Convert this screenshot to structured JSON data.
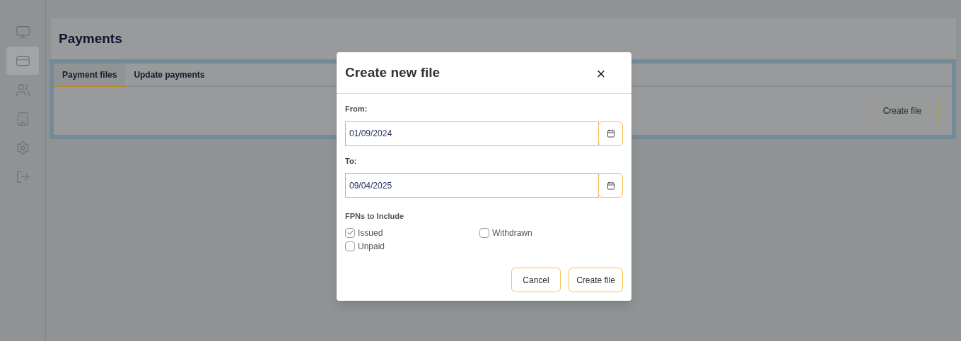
{
  "sidebar": {
    "items": [
      {
        "kind": "monitor",
        "selected": false
      },
      {
        "kind": "card",
        "selected": true
      },
      {
        "kind": "people",
        "selected": false
      },
      {
        "kind": "building",
        "selected": false
      },
      {
        "kind": "settings",
        "selected": false
      },
      {
        "kind": "logout",
        "selected": false
      }
    ]
  },
  "page": {
    "title": "Payments"
  },
  "tabs": [
    {
      "label": "Payment files",
      "selected": true
    },
    {
      "label": "Update payments",
      "selected": false
    }
  ],
  "panel": {
    "button": "Create file"
  },
  "dialog": {
    "title": "Create new file",
    "close": "×",
    "fields": [
      {
        "label": "From:",
        "value": "01/09/2024"
      },
      {
        "label": "To:",
        "value": "09/04/2025"
      }
    ],
    "group_label": "FPNs to Include",
    "options": [
      {
        "label": "Issued",
        "checked": true
      },
      {
        "label": "Withdrawn",
        "checked": false
      },
      {
        "label": "Unpaid",
        "checked": false
      }
    ],
    "buttons": [
      "Cancel",
      "Create file"
    ]
  }
}
